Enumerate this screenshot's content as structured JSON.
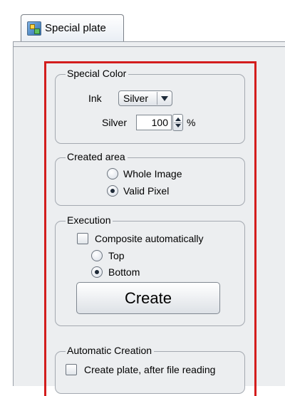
{
  "tab": {
    "label": "Special plate",
    "icon": "plate-layers-icon"
  },
  "special_color": {
    "title": "Special Color",
    "ink_label": "Ink",
    "ink_value": "Silver",
    "silver_label": "Silver",
    "silver_value": "100",
    "percent_label": "%"
  },
  "created_area": {
    "title": "Created area",
    "options": [
      {
        "label": "Whole Image",
        "selected": false
      },
      {
        "label": "Valid Pixel",
        "selected": true
      }
    ]
  },
  "execution": {
    "title": "Execution",
    "composite_label": "Composite automatically",
    "composite_checked": false,
    "options": [
      {
        "label": "Top",
        "selected": false
      },
      {
        "label": "Bottom",
        "selected": true
      }
    ],
    "create_label": "Create"
  },
  "automatic_creation": {
    "title": "Automatic Creation",
    "checkbox_label": "Create plate, after file reading",
    "checked": false
  },
  "colors": {
    "highlight_frame": "#d31d1d"
  }
}
